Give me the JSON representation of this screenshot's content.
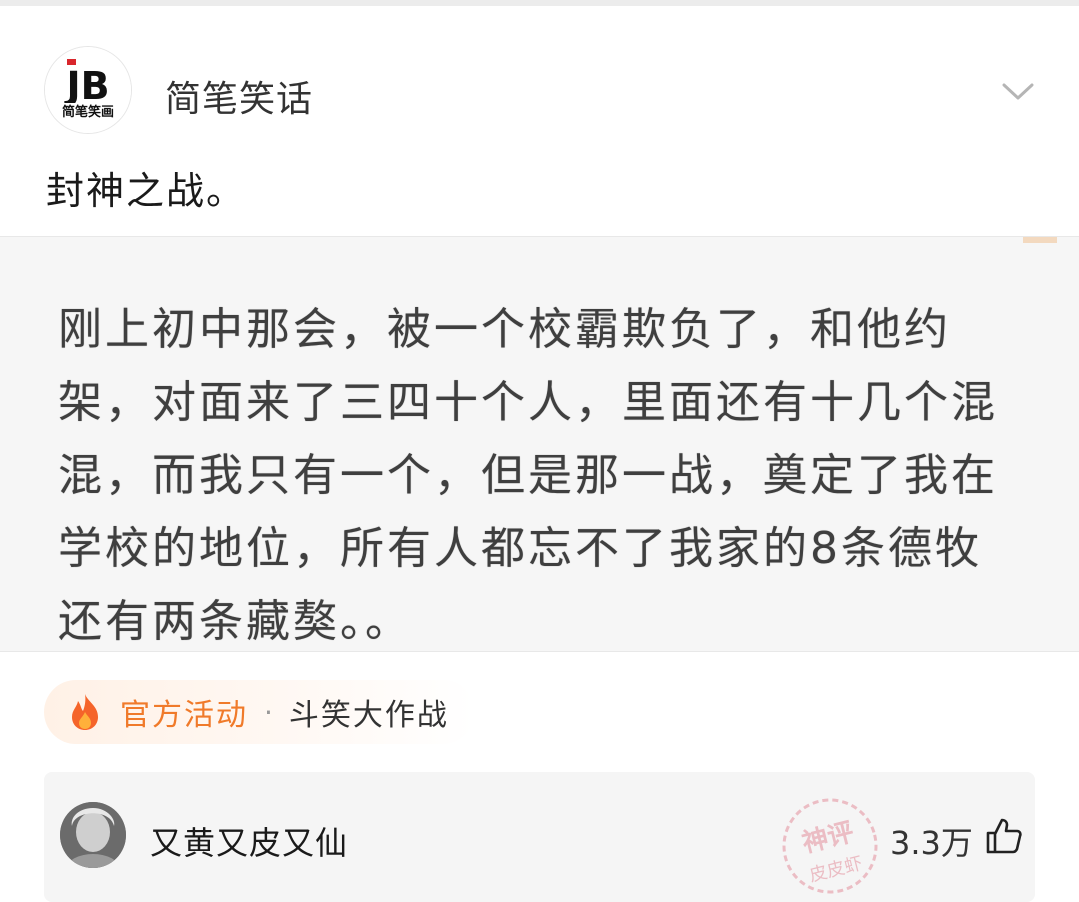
{
  "post": {
    "author": "简笔笑话",
    "avatar_text": "JB",
    "avatar_subtext": "简笔笑画",
    "text": "封神之战。",
    "quote": "刚上初中那会，被一个校霸欺负了，和他约架，对面来了三四十个人，里面还有十几个混混，而我只有一个，但是那一战，奠定了我在学校的地位，所有人都忘不了我家的8条德牧还有两条藏獒。。"
  },
  "activity": {
    "label": "官方活动",
    "separator": "·",
    "topic": "斗笑大作战"
  },
  "comment": {
    "user": "又黄又皮又仙",
    "likes": "3.3万",
    "watermark_top": "神评",
    "watermark_bottom": "皮皮虾"
  },
  "icons": {
    "menu": "chevron-down-icon",
    "activity": "flame-icon",
    "like": "thumbs-up-icon"
  },
  "colors": {
    "accent": "#f07a2a",
    "watermark": "#e07a8a"
  }
}
